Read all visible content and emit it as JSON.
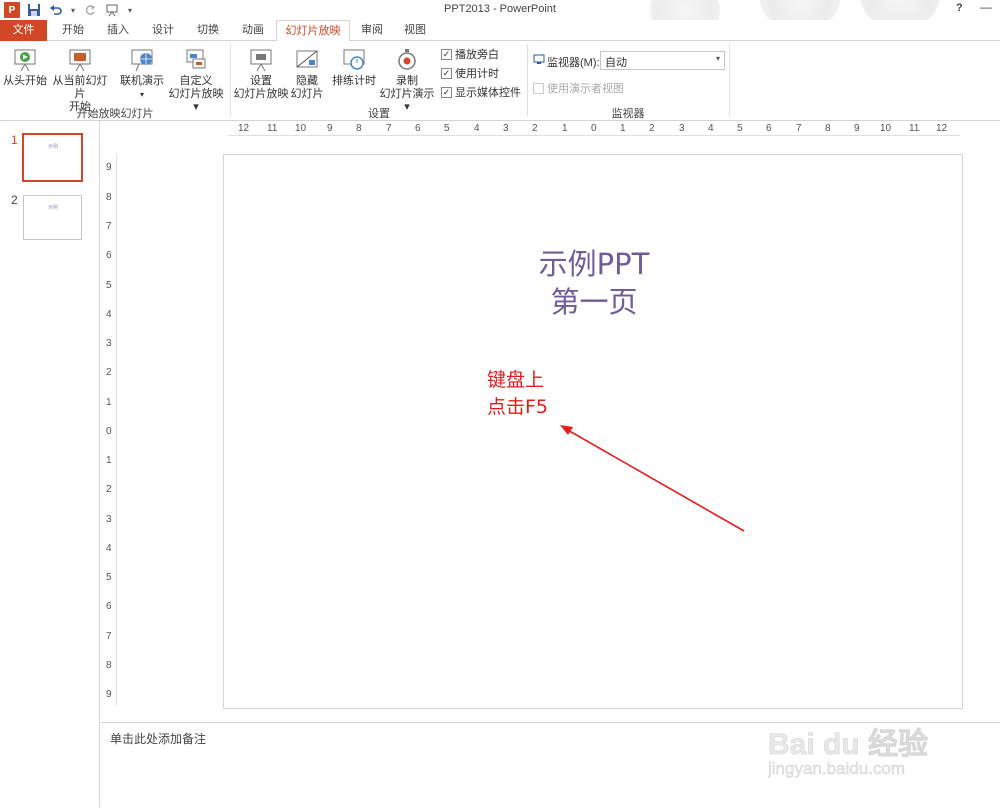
{
  "window": {
    "title": "PPT2013 - PowerPoint",
    "help_label": "?",
    "minimize_label": "—"
  },
  "qat": {
    "app_icon": "P",
    "save_icon": "save-icon",
    "undo_icon": "undo-icon",
    "redo_icon": "redo-icon",
    "start_icon": "present-icon"
  },
  "tabs": [
    {
      "label": "文件"
    },
    {
      "label": "开始"
    },
    {
      "label": "插入"
    },
    {
      "label": "设计"
    },
    {
      "label": "切换"
    },
    {
      "label": "动画"
    },
    {
      "label": "幻灯片放映"
    },
    {
      "label": "审阅"
    },
    {
      "label": "视图"
    }
  ],
  "ribbon": {
    "groups": [
      {
        "label": "开始放映幻灯片"
      },
      {
        "label": "设置"
      },
      {
        "label": "监视器"
      }
    ],
    "buttons": {
      "from_beginning": "从头开始",
      "from_current_1": "从当前幻灯片",
      "from_current_2": "开始",
      "online_1": "联机演示",
      "online_2": "▾",
      "custom_1": "自定义",
      "custom_2": "幻灯片放映 ▾",
      "setup_1": "设置",
      "setup_2": "幻灯片放映",
      "hide_1": "隐藏",
      "hide_2": "幻灯片",
      "rehearse": "排练计时",
      "record_1": "录制",
      "record_2": "幻灯片演示 ▾"
    },
    "checkboxes": [
      {
        "label": "播放旁白",
        "checked": "✓"
      },
      {
        "label": "使用计时",
        "checked": "✓"
      },
      {
        "label": "显示媒体控件",
        "checked": "✓"
      }
    ],
    "monitor": {
      "label": "监视器(M):",
      "value": "自动",
      "presenter_view": "使用演示者视图"
    }
  },
  "slides": [
    {
      "number": "1"
    },
    {
      "number": "2"
    }
  ],
  "rulers": {
    "horizontal": [
      "12",
      "11",
      "10",
      "9",
      "8",
      "7",
      "6",
      "5",
      "4",
      "3",
      "2",
      "1",
      "0",
      "1",
      "2",
      "3",
      "4",
      "5",
      "6",
      "7",
      "8",
      "9",
      "10",
      "11",
      "12"
    ],
    "vertical": [
      "9",
      "8",
      "7",
      "6",
      "5",
      "4",
      "3",
      "2",
      "1",
      "0",
      "1",
      "2",
      "3",
      "4",
      "5",
      "6",
      "7",
      "8",
      "9"
    ]
  },
  "slide": {
    "title_line1": "示例PPT",
    "title_line2": "第一页",
    "annotation_line1": "键盘上",
    "annotation_line2": "点击F5"
  },
  "notes": {
    "placeholder": "单击此处添加备注"
  },
  "watermark": {
    "brand": "Bai du 经验",
    "url": "jingyan.baidu.com"
  },
  "colors": {
    "accent": "#d24726",
    "title_text": "#6f5c98",
    "annotation": "#e31d1d"
  }
}
